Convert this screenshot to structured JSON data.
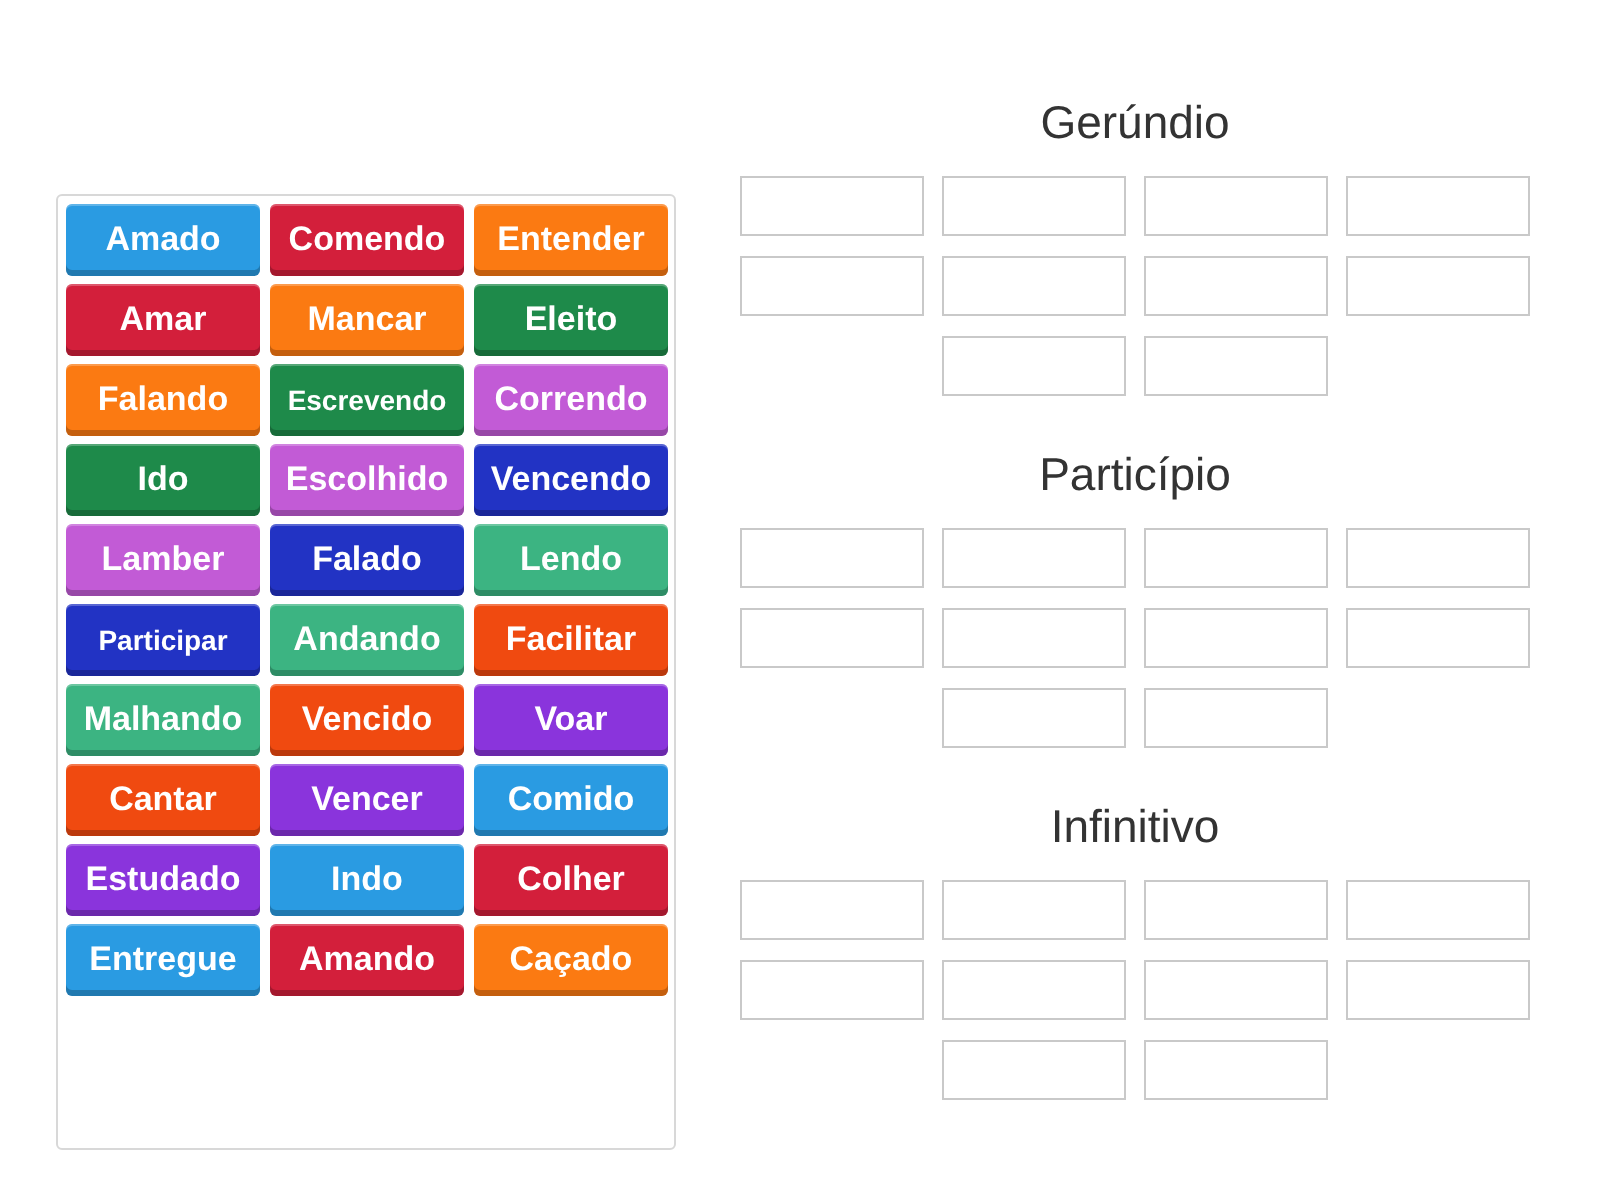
{
  "tiles": [
    {
      "label": "Amado",
      "color": "#2a9be2"
    },
    {
      "label": "Comendo",
      "color": "#d31f3b"
    },
    {
      "label": "Entender",
      "color": "#fb7a12"
    },
    {
      "label": "Amar",
      "color": "#d31f3b"
    },
    {
      "label": "Mancar",
      "color": "#fb7a12"
    },
    {
      "label": "Eleito",
      "color": "#1e8a4a"
    },
    {
      "label": "Falando",
      "color": "#fb7a12"
    },
    {
      "label": "Escrevendo",
      "color": "#1e8a4a"
    },
    {
      "label": "Correndo",
      "color": "#c25bd6"
    },
    {
      "label": "Ido",
      "color": "#1e8a4a"
    },
    {
      "label": "Escolhido",
      "color": "#c25bd6"
    },
    {
      "label": "Vencendo",
      "color": "#2233c4"
    },
    {
      "label": "Lamber",
      "color": "#c25bd6"
    },
    {
      "label": "Falado",
      "color": "#2233c4"
    },
    {
      "label": "Lendo",
      "color": "#3cb482"
    },
    {
      "label": "Participar",
      "color": "#2233c4"
    },
    {
      "label": "Andando",
      "color": "#3cb482"
    },
    {
      "label": "Facilitar",
      "color": "#f04a10"
    },
    {
      "label": "Malhando",
      "color": "#3cb482"
    },
    {
      "label": "Vencido",
      "color": "#f04a10"
    },
    {
      "label": "Voar",
      "color": "#8a34dc"
    },
    {
      "label": "Cantar",
      "color": "#f04a10"
    },
    {
      "label": "Vencer",
      "color": "#8a34dc"
    },
    {
      "label": "Comido",
      "color": "#2a9be2"
    },
    {
      "label": "Estudado",
      "color": "#8a34dc"
    },
    {
      "label": "Indo",
      "color": "#2a9be2"
    },
    {
      "label": "Colher",
      "color": "#d31f3b"
    },
    {
      "label": "Entregue",
      "color": "#2a9be2"
    },
    {
      "label": "Amando",
      "color": "#d31f3b"
    },
    {
      "label": "Caçado",
      "color": "#fb7a12"
    }
  ],
  "groups": [
    {
      "title": "Gerúndio",
      "slots": [
        {
          "filled": false
        },
        {
          "filled": false
        },
        {
          "filled": false
        },
        {
          "filled": false
        },
        {
          "filled": false
        },
        {
          "filled": false
        },
        {
          "filled": false
        },
        {
          "filled": false
        },
        {
          "filled": false
        },
        {
          "filled": false
        }
      ]
    },
    {
      "title": "Particípio",
      "slots": [
        {
          "filled": false
        },
        {
          "filled": false
        },
        {
          "filled": false
        },
        {
          "filled": false
        },
        {
          "filled": false
        },
        {
          "filled": false
        },
        {
          "filled": false
        },
        {
          "filled": false
        },
        {
          "filled": false
        },
        {
          "filled": false
        }
      ]
    },
    {
      "title": "Infinitivo",
      "slots": [
        {
          "filled": false
        },
        {
          "filled": false
        },
        {
          "filled": false
        },
        {
          "filled": false
        },
        {
          "filled": false
        },
        {
          "filled": false
        },
        {
          "filled": false
        },
        {
          "filled": false
        },
        {
          "filled": false
        },
        {
          "filled": false
        }
      ]
    }
  ]
}
